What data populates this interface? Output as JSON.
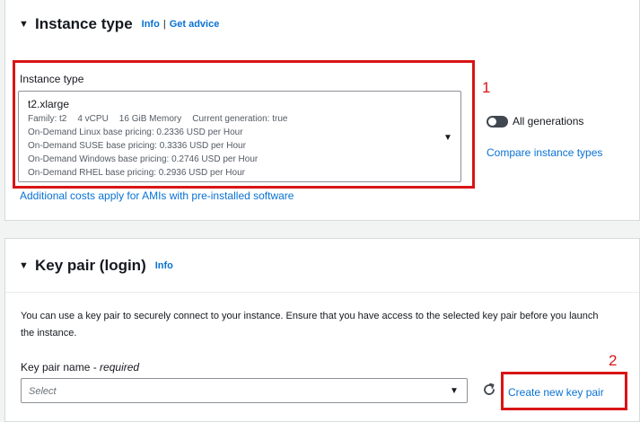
{
  "instance_section": {
    "title": "Instance type",
    "info_link": "Info",
    "advice_link": "Get advice",
    "field_label": "Instance type",
    "selected": {
      "name": "t2.xlarge",
      "family": "Family: t2",
      "vcpu": "4 vCPU",
      "memory": "16 GiB Memory",
      "generation": "Current generation: true",
      "linux": "On-Demand Linux base pricing: 0.2336 USD per Hour",
      "suse": "On-Demand SUSE base pricing: 0.3336 USD per Hour",
      "windows": "On-Demand Windows base pricing: 0.2746 USD per Hour",
      "rhel": "On-Demand RHEL base pricing: 0.2936 USD per Hour"
    },
    "all_generations_label": "All generations",
    "all_generations_enabled": false,
    "compare_link": "Compare instance types",
    "additional_costs_link": "Additional costs apply for AMIs with pre-installed software"
  },
  "keypair_section": {
    "title": "Key pair (login)",
    "info_link": "Info",
    "description": "You can use a key pair to securely connect to your instance. Ensure that you have access to the selected key pair before you launch the instance.",
    "field_label": "Key pair name",
    "field_required": "required",
    "select_placeholder": "Select",
    "create_link": "Create new key pair"
  },
  "annotations": {
    "box1_number": "1",
    "box2_number": "2"
  },
  "colors": {
    "annotation_red": "#d91515",
    "link_blue": "#0972d3"
  },
  "icons": [
    "caret-down-icon",
    "dropdown-arrow-icon",
    "toggle-switch",
    "refresh-icon"
  ]
}
